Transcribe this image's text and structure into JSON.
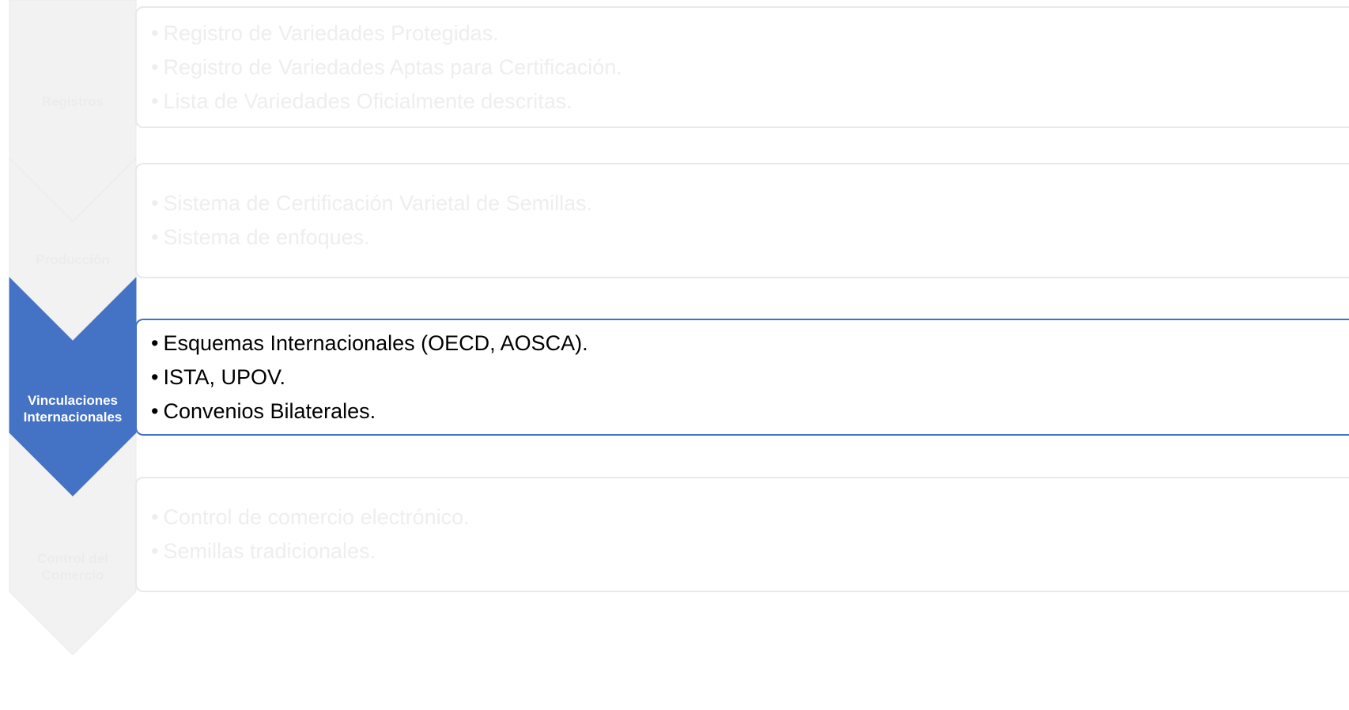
{
  "colors": {
    "accent": "#4472c4",
    "inactive_fill": "#f2f2f2",
    "inactive_border": "#e9e9e9",
    "inactive_text": "#eeeeee",
    "active_text": "#000000",
    "active_label_text": "#ffffff"
  },
  "bullet": "•",
  "steps": [
    {
      "label": "Registros",
      "active": false,
      "items": [
        "Registro de Variedades Protegidas.",
        "Registro de Variedades Aptas para Certificación.",
        "Lista de Variedades Oficialmente descritas."
      ]
    },
    {
      "label": "Producción",
      "active": false,
      "items": [
        "Sistema de Certificación Varietal de Semillas.",
        "Sistema de enfoques."
      ]
    },
    {
      "label_lines": [
        "Vinculaciones",
        "Internacionales"
      ],
      "active": true,
      "items": [
        "Esquemas Internacionales (OECD, AOSCA).",
        "ISTA, UPOV.",
        "Convenios Bilaterales."
      ]
    },
    {
      "label_lines": [
        "Control del",
        "Comercio"
      ],
      "active": false,
      "items": [
        "Control de comercio electrónico.",
        "Semillas tradicionales."
      ]
    }
  ]
}
